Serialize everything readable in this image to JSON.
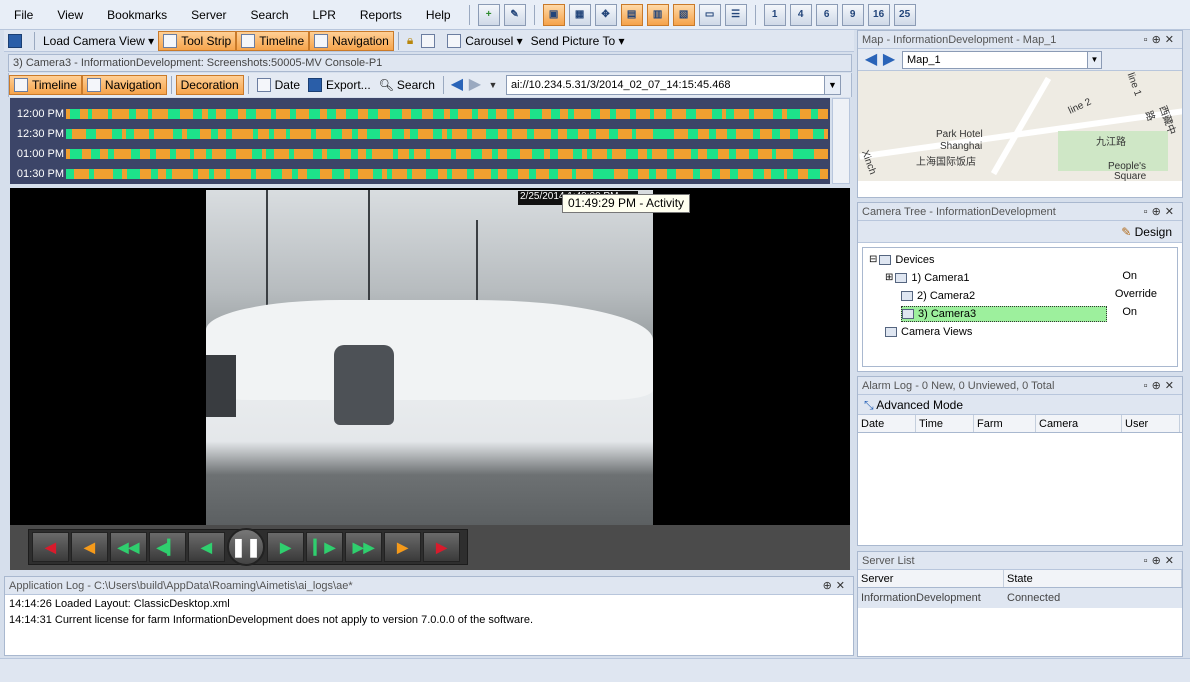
{
  "menu": [
    "File",
    "View",
    "Bookmarks",
    "Server",
    "Search",
    "LPR",
    "Reports",
    "Help"
  ],
  "layout_icons": [
    "1",
    "4",
    "6",
    "9",
    "16",
    "25"
  ],
  "toolbar": {
    "load_camera_view": "Load Camera View",
    "tool_strip": "Tool Strip",
    "timeline": "Timeline",
    "navigation": "Navigation",
    "carousel": "Carousel",
    "send_picture_to": "Send Picture To"
  },
  "camera_panel": {
    "title": "3) Camera3 - InformationDevelopment: Screenshots:50005-MV Console-P1",
    "tools": {
      "timeline": "Timeline",
      "navigation": "Navigation",
      "decoration": "Decoration",
      "date": "Date",
      "export": "Export...",
      "search": "Search"
    },
    "url": "ai://10.234.5.31/3/2014_02_07_14:15:45.468",
    "timeline_rows": [
      "12:00 PM",
      "12:30 PM",
      "01:00 PM",
      "01:30 PM"
    ],
    "tooltip": "01:49:29 PM - Activity",
    "osd_text": "2/25/2014 1:49:29 PM"
  },
  "app_log": {
    "title": "Application Log - C:\\Users\\build\\AppData\\Roaming\\Aimetis\\ai_logs\\ae*",
    "lines": [
      "14:14:26 Loaded Layout: ClassicDesktop.xml",
      "14:14:31 Current license for farm InformationDevelopment does not apply to version 7.0.0.0 of the software."
    ]
  },
  "map_panel": {
    "title": "Map - InformationDevelopment - Map_1",
    "map_name": "Map_1",
    "labels": [
      "Park Hotel",
      "Shanghai",
      "上海国际饭店",
      "九江路",
      "People's",
      "Square",
      "line 2",
      "line 1",
      "西藏中路",
      "Xinch"
    ]
  },
  "camera_tree": {
    "title": "Camera Tree - InformationDevelopment",
    "design": "Design",
    "root": "Devices",
    "cameras": [
      {
        "label": "1) Camera1",
        "state": "On"
      },
      {
        "label": "2) Camera2",
        "state": "Override"
      },
      {
        "label": "3) Camera3",
        "state": "On"
      }
    ],
    "views": "Camera Views"
  },
  "alarm_log": {
    "title": "Alarm Log - 0 New, 0 Unviewed, 0 Total",
    "advanced_mode": "Advanced Mode",
    "columns": [
      "Date",
      "Time",
      "Farm",
      "Camera",
      "User"
    ]
  },
  "server_list": {
    "title": "Server List",
    "columns": [
      "Server",
      "State"
    ],
    "rows": [
      {
        "server": "InformationDevelopment",
        "state": "Connected"
      }
    ]
  },
  "colors": {
    "accent_orange": "#f6a44c",
    "timeline_bg": "#3c4568",
    "selected_green": "#9df09d"
  }
}
